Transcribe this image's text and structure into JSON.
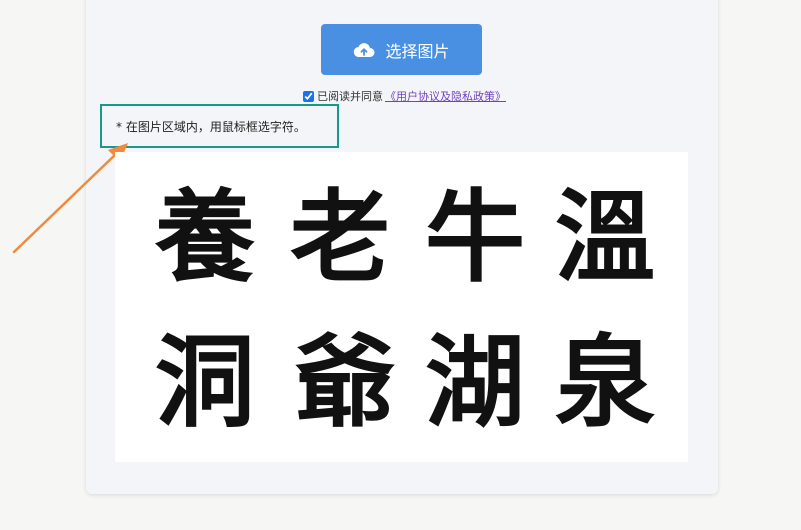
{
  "upload_button": {
    "label": "选择图片",
    "icon": "cloud-upload-icon",
    "color": "#4a90e2"
  },
  "agreement": {
    "checked": true,
    "text": "已阅读并同意",
    "link_text": "《用户协议及隐私政策》"
  },
  "hint": {
    "text": "* 在图片区域内，用鼠标框选字符。",
    "border_color": "#179a8c"
  },
  "annotation_arrow": {
    "color": "#f08a3c"
  },
  "image_characters": [
    "養",
    "老",
    "牛",
    "溫",
    "洞",
    "爺",
    "湖",
    "泉"
  ]
}
